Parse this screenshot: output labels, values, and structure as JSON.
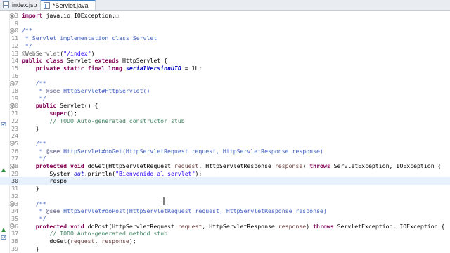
{
  "tabs": [
    {
      "label": "index.jsp",
      "active": false
    },
    {
      "label": "*Servlet.java",
      "active": true
    }
  ],
  "editor": {
    "current_line": 30,
    "lines": [
      {
        "n": "3",
        "fold": "+",
        "tokens": [
          {
            "t": "import",
            "c": "kw"
          },
          {
            "t": " java.io.IOException;",
            "c": ""
          },
          {
            "t": "☐",
            "c": "an"
          }
        ]
      },
      {
        "n": "9",
        "tokens": []
      },
      {
        "n": "10",
        "fold": "-",
        "tokens": [
          {
            "t": "/**",
            "c": "cm"
          }
        ]
      },
      {
        "n": "11",
        "tokens": [
          {
            "t": " * ",
            "c": "cm"
          },
          {
            "t": "Servlet",
            "c": "cm ul"
          },
          {
            "t": " implementation class ",
            "c": "cm"
          },
          {
            "t": "Servlet",
            "c": "cm ul"
          }
        ]
      },
      {
        "n": "12",
        "tokens": [
          {
            "t": " */",
            "c": "cm"
          }
        ]
      },
      {
        "n": "13",
        "tokens": [
          {
            "t": "@WebServlet",
            "c": "an"
          },
          {
            "t": "(",
            "c": ""
          },
          {
            "t": "\"/index\"",
            "c": "st"
          },
          {
            "t": ")",
            "c": ""
          }
        ]
      },
      {
        "n": "14",
        "tokens": [
          {
            "t": "public class",
            "c": "kw"
          },
          {
            "t": " Servlet ",
            "c": ""
          },
          {
            "t": "extends",
            "c": "kw"
          },
          {
            "t": " HttpServlet {",
            "c": ""
          }
        ]
      },
      {
        "n": "15",
        "tokens": [
          {
            "t": "    ",
            "c": ""
          },
          {
            "t": "private static final long",
            "c": "kw"
          },
          {
            "t": " ",
            "c": ""
          },
          {
            "t": "serialVersionUID",
            "c": "fi"
          },
          {
            "t": " = 1L;",
            "c": ""
          }
        ]
      },
      {
        "n": "16",
        "tokens": []
      },
      {
        "n": "17",
        "fold": "-",
        "tokens": [
          {
            "t": "    /**",
            "c": "cm"
          }
        ]
      },
      {
        "n": "18",
        "tokens": [
          {
            "t": "     * ",
            "c": "cm"
          },
          {
            "t": "@see",
            "c": "tag"
          },
          {
            "t": " HttpServlet#HttpServlet()",
            "c": "cm"
          }
        ]
      },
      {
        "n": "19",
        "tokens": [
          {
            "t": "     */",
            "c": "cm"
          }
        ]
      },
      {
        "n": "20",
        "fold": "-",
        "tokens": [
          {
            "t": "    ",
            "c": ""
          },
          {
            "t": "public",
            "c": "kw"
          },
          {
            "t": " Servlet() {",
            "c": ""
          }
        ]
      },
      {
        "n": "21",
        "tokens": [
          {
            "t": "        ",
            "c": ""
          },
          {
            "t": "super",
            "c": "kw"
          },
          {
            "t": "();",
            "c": ""
          }
        ]
      },
      {
        "n": "22",
        "marker": "task",
        "tokens": [
          {
            "t": "        ",
            "c": ""
          },
          {
            "t": "// TODO Auto-generated constructor stub",
            "c": "cmi"
          }
        ]
      },
      {
        "n": "23",
        "tokens": [
          {
            "t": "    }",
            "c": ""
          }
        ]
      },
      {
        "n": "24",
        "tokens": []
      },
      {
        "n": "25",
        "fold": "-",
        "tokens": [
          {
            "t": "    /**",
            "c": "cm"
          }
        ]
      },
      {
        "n": "26",
        "tokens": [
          {
            "t": "     * ",
            "c": "cm"
          },
          {
            "t": "@see",
            "c": "tag"
          },
          {
            "t": " HttpServlet#doGet(HttpServletRequest request, HttpServletResponse response)",
            "c": "cm"
          }
        ]
      },
      {
        "n": "27",
        "tokens": [
          {
            "t": "     */",
            "c": "cm"
          }
        ]
      },
      {
        "n": "28",
        "fold": "-",
        "marker": "override",
        "tokens": [
          {
            "t": "    ",
            "c": ""
          },
          {
            "t": "protected void",
            "c": "kw"
          },
          {
            "t": " doGet(HttpServletRequest ",
            "c": ""
          },
          {
            "t": "request",
            "c": "pa"
          },
          {
            "t": ", HttpServletResponse ",
            "c": ""
          },
          {
            "t": "response",
            "c": "pa"
          },
          {
            "t": ") ",
            "c": ""
          },
          {
            "t": "throws",
            "c": "kw"
          },
          {
            "t": " ServletException, IOException {",
            "c": ""
          }
        ]
      },
      {
        "n": "29",
        "tokens": [
          {
            "t": "        System.",
            "c": ""
          },
          {
            "t": "out",
            "c": "sf"
          },
          {
            "t": ".println(",
            "c": ""
          },
          {
            "t": "\"Bienvenido al servlet\"",
            "c": "st"
          },
          {
            "t": ");",
            "c": ""
          }
        ]
      },
      {
        "n": "30",
        "tokens": [
          {
            "t": "        respo",
            "c": ""
          }
        ]
      },
      {
        "n": "31",
        "tokens": [
          {
            "t": "    }",
            "c": ""
          }
        ]
      },
      {
        "n": "32",
        "tokens": []
      },
      {
        "n": "33",
        "fold": "-",
        "tokens": [
          {
            "t": "    /**",
            "c": "cm"
          }
        ]
      },
      {
        "n": "34",
        "tokens": [
          {
            "t": "     * ",
            "c": "cm"
          },
          {
            "t": "@see",
            "c": "tag"
          },
          {
            "t": " HttpServlet#doPost(HttpServletRequest request, HttpServletResponse response)",
            "c": "cm"
          }
        ]
      },
      {
        "n": "35",
        "tokens": [
          {
            "t": "     */",
            "c": "cm"
          }
        ]
      },
      {
        "n": "36",
        "fold": "-",
        "marker": "override",
        "tokens": [
          {
            "t": "    ",
            "c": ""
          },
          {
            "t": "protected void",
            "c": "kw"
          },
          {
            "t": " doPost(HttpServletRequest ",
            "c": ""
          },
          {
            "t": "request",
            "c": "pa"
          },
          {
            "t": ", HttpServletResponse ",
            "c": ""
          },
          {
            "t": "response",
            "c": "pa"
          },
          {
            "t": ") ",
            "c": ""
          },
          {
            "t": "throws",
            "c": "kw"
          },
          {
            "t": " ServletException, IOException {",
            "c": ""
          }
        ]
      },
      {
        "n": "37",
        "marker": "task",
        "tokens": [
          {
            "t": "        ",
            "c": ""
          },
          {
            "t": "// TODO Auto-generated method stub",
            "c": "cmi"
          }
        ]
      },
      {
        "n": "38",
        "tokens": [
          {
            "t": "        doGet(",
            "c": ""
          },
          {
            "t": "request",
            "c": "pa"
          },
          {
            "t": ", ",
            "c": ""
          },
          {
            "t": "response",
            "c": "pa"
          },
          {
            "t": ");",
            "c": ""
          }
        ]
      },
      {
        "n": "39",
        "tokens": [
          {
            "t": "    }",
            "c": ""
          }
        ]
      }
    ]
  },
  "icons": {
    "file_jsp": "jsp-file-icon",
    "file_java": "java-file-icon",
    "cursor": "text-cursor-icon"
  }
}
